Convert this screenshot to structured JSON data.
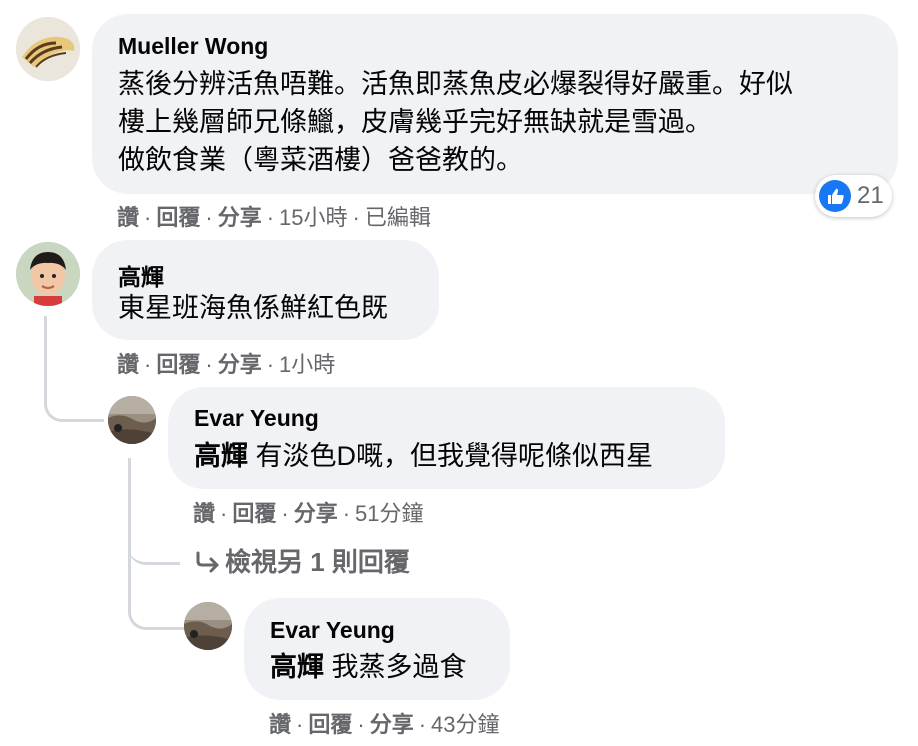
{
  "comments": [
    {
      "author": "Mueller Wong",
      "lines": [
        "蒸後分辨活魚唔難。活魚即蒸魚皮必爆裂得好嚴重。好似",
        "樓上幾層師兄條鱲，皮膚幾乎完好無缺就是雪過。",
        "做飲食業（粵菜酒樓）爸爸教的。"
      ],
      "actions": {
        "like": "讚",
        "reply": "回覆",
        "share": "分享",
        "time": "15小時",
        "edited": "已編輯"
      },
      "reaction_count": "21"
    },
    {
      "author": "高輝",
      "text": "東星班海魚係鮮紅色既",
      "actions": {
        "like": "讚",
        "reply": "回覆",
        "share": "分享",
        "time": "1小時"
      }
    }
  ],
  "replies": [
    {
      "author": "Evar Yeung",
      "mention": "高輝",
      "text": " 有淡色D嘅，但我覺得呢條似西星",
      "actions": {
        "like": "讚",
        "reply": "回覆",
        "share": "分享",
        "time": "51分鐘"
      }
    },
    {
      "author": "Evar Yeung",
      "mention": "高輝",
      "text": " 我蒸多過食",
      "actions": {
        "like": "讚",
        "reply": "回覆",
        "share": "分享",
        "time": "43分鐘"
      }
    }
  ],
  "view_more": {
    "icon": "reply-arrow-icon",
    "label": "檢視另 1 則回覆"
  },
  "colors": {
    "bubble": "#f0f2f5",
    "meta": "#65676b",
    "like_blue": "#1877f2",
    "thread_line": "#d4d7dc"
  }
}
